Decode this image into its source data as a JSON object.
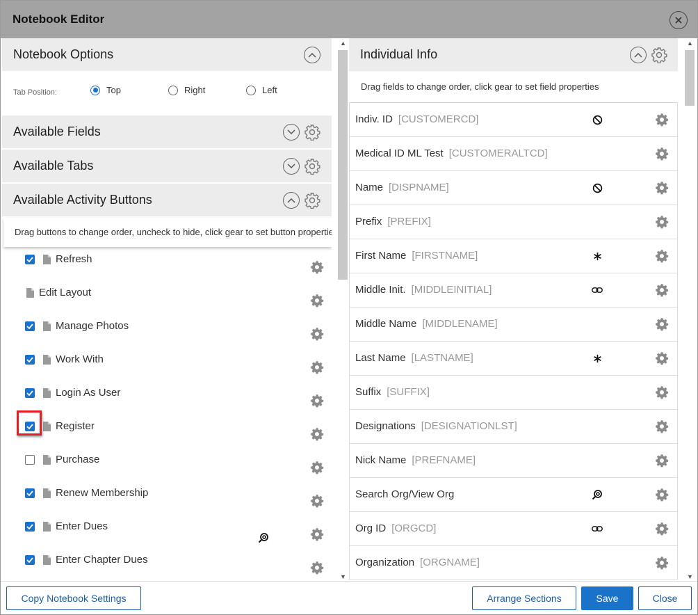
{
  "dialog": {
    "title": "Notebook Editor"
  },
  "notebook_options": {
    "label": "Notebook Options",
    "tab_position_label": "Tab Position:",
    "options": [
      {
        "label": "Top",
        "selected": true
      },
      {
        "label": "Right",
        "selected": false
      },
      {
        "label": "Left",
        "selected": false
      }
    ]
  },
  "available_fields": {
    "label": "Available Fields"
  },
  "available_tabs": {
    "label": "Available Tabs"
  },
  "activity_buttons": {
    "label": "Available Activity Buttons",
    "hint": "Drag buttons to change order, uncheck to hide, click gear to set button properties",
    "items": [
      {
        "label": "Refresh",
        "checkbox": true,
        "checked": true,
        "status_icon": ""
      },
      {
        "label": "Edit Layout",
        "checkbox": false,
        "checked": false,
        "status_icon": ""
      },
      {
        "label": "Manage Photos",
        "checkbox": true,
        "checked": true,
        "status_icon": ""
      },
      {
        "label": "Work With",
        "checkbox": true,
        "checked": true,
        "status_icon": ""
      },
      {
        "label": "Login As User",
        "checkbox": true,
        "checked": true,
        "status_icon": ""
      },
      {
        "label": "Register",
        "checkbox": true,
        "checked": true,
        "status_icon": ""
      },
      {
        "label": "Purchase",
        "checkbox": true,
        "checked": false,
        "status_icon": ""
      },
      {
        "label": "Renew Membership",
        "checkbox": true,
        "checked": true,
        "status_icon": ""
      },
      {
        "label": "Enter Dues",
        "checkbox": true,
        "checked": true,
        "status_icon": "search-link-icon"
      },
      {
        "label": "Enter Chapter Dues",
        "checkbox": true,
        "checked": true,
        "status_icon": ""
      }
    ]
  },
  "individual_info": {
    "label": "Individual Info",
    "hint": "Drag fields to change order, click gear to set field properties",
    "fields": [
      {
        "name": "Indiv. ID",
        "code": "[CUSTOMERCD]",
        "status_icon": "ban-icon"
      },
      {
        "name": "Medical ID ML Test",
        "code": "[CUSTOMERALTCD]",
        "status_icon": ""
      },
      {
        "name": "Name",
        "code": "[DISPNAME]",
        "status_icon": "ban-icon"
      },
      {
        "name": "Prefix",
        "code": "[PREFIX]",
        "status_icon": ""
      },
      {
        "name": "First Name",
        "code": "[FIRSTNAME]",
        "status_icon": "asterisk-icon"
      },
      {
        "name": "Middle Init.",
        "code": "[MIDDLEINITIAL]",
        "status_icon": "link-icon"
      },
      {
        "name": "Middle Name",
        "code": "[MIDDLENAME]",
        "status_icon": ""
      },
      {
        "name": "Last Name",
        "code": "[LASTNAME]",
        "status_icon": "asterisk-icon"
      },
      {
        "name": "Suffix",
        "code": "[SUFFIX]",
        "status_icon": ""
      },
      {
        "name": "Designations",
        "code": "[DESIGNATIONLST]",
        "status_icon": ""
      },
      {
        "name": "Nick Name",
        "code": "[PREFNAME]",
        "status_icon": ""
      },
      {
        "name": "Search Org/View Org",
        "code": "",
        "status_icon": "search-link-icon"
      },
      {
        "name": "Org ID",
        "code": "[ORGCD]",
        "status_icon": "link-icon"
      },
      {
        "name": "Organization",
        "code": "[ORGNAME]",
        "status_icon": ""
      }
    ]
  },
  "footer": {
    "copy_label": "Copy Notebook Settings",
    "arrange_label": "Arrange Sections",
    "save_label": "Save",
    "close_label": "Close"
  },
  "colors": {
    "accent": "#1a73c8",
    "titlebar": "#a3a3a3",
    "section_header": "#ececec",
    "highlight": "#e31e24"
  }
}
